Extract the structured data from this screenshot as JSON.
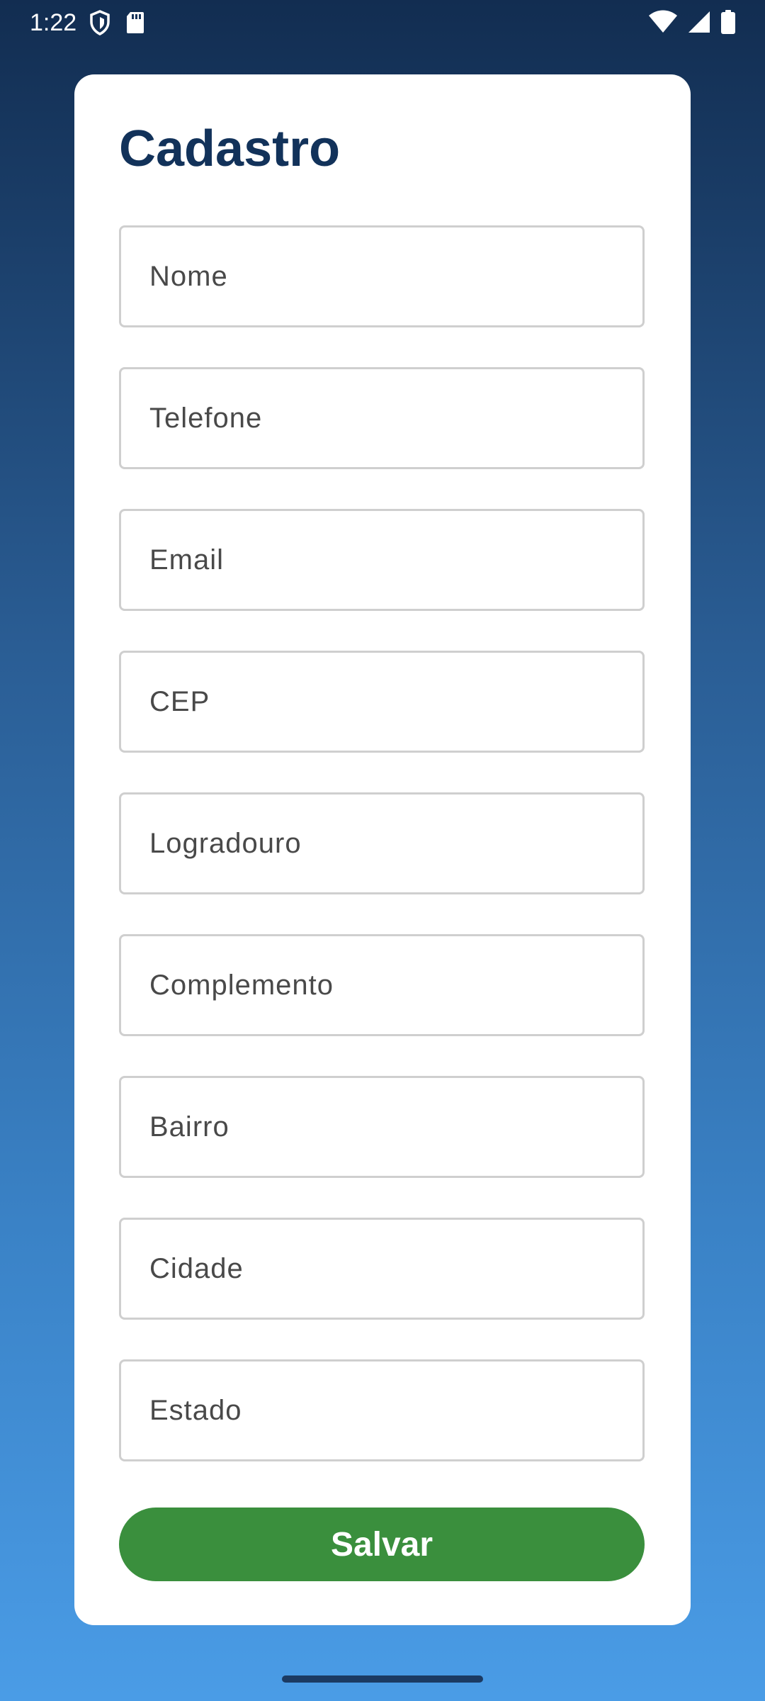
{
  "status_bar": {
    "time": "1:22",
    "left_icons": [
      "shield-icon",
      "sd-card-icon"
    ],
    "right_icons": [
      "wifi-icon",
      "signal-icon",
      "battery-icon"
    ]
  },
  "form": {
    "title": "Cadastro",
    "fields": [
      {
        "placeholder": "Nome",
        "value": ""
      },
      {
        "placeholder": "Telefone",
        "value": ""
      },
      {
        "placeholder": "Email",
        "value": ""
      },
      {
        "placeholder": "CEP",
        "value": ""
      },
      {
        "placeholder": "Logradouro",
        "value": ""
      },
      {
        "placeholder": "Complemento",
        "value": ""
      },
      {
        "placeholder": "Bairro",
        "value": ""
      },
      {
        "placeholder": "Cidade",
        "value": ""
      },
      {
        "placeholder": "Estado",
        "value": ""
      }
    ],
    "save_label": "Salvar"
  },
  "colors": {
    "title": "#12325a",
    "button": "#3a8f3d",
    "background_top": "#122d51",
    "background_bottom": "#4a9ce6"
  }
}
